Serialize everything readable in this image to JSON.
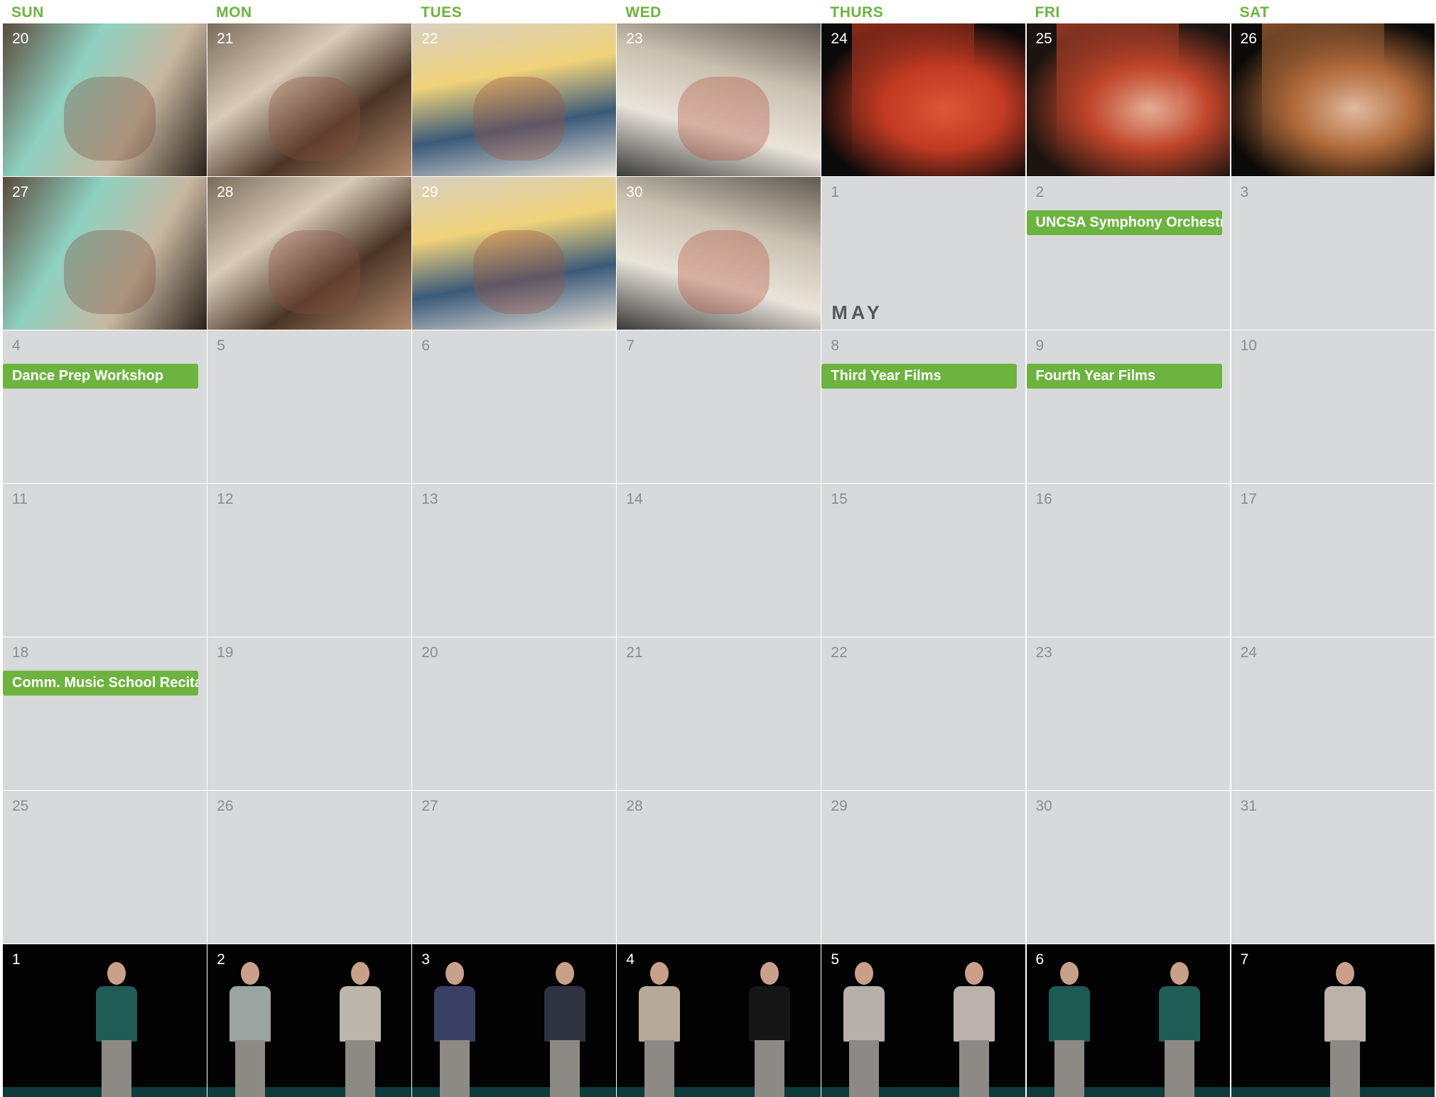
{
  "header": {
    "days": [
      "SUN",
      "MON",
      "TUES",
      "WED",
      "THURS",
      "FRI",
      "SAT"
    ]
  },
  "colors": {
    "accent": "#6db33f",
    "cell_bg": "#d8d9db",
    "day_number": "#8a8c8f",
    "month_label": "#555759"
  },
  "month_label": "MAY",
  "weeks": [
    {
      "days": [
        {
          "num": "20",
          "style": "photo"
        },
        {
          "num": "21",
          "style": "photo"
        },
        {
          "num": "22",
          "style": "photo"
        },
        {
          "num": "23",
          "style": "photo"
        },
        {
          "num": "24",
          "style": "photo-stage"
        },
        {
          "num": "25",
          "style": "photo-stage"
        },
        {
          "num": "26",
          "style": "photo-stage"
        }
      ]
    },
    {
      "days": [
        {
          "num": "27",
          "style": "photo"
        },
        {
          "num": "28",
          "style": "photo"
        },
        {
          "num": "29",
          "style": "photo"
        },
        {
          "num": "30",
          "style": "photo"
        },
        {
          "num": "1",
          "style": "plain",
          "month_start": true
        },
        {
          "num": "2",
          "style": "plain",
          "event": "UNCSA Symphony Orchestra"
        },
        {
          "num": "3",
          "style": "plain"
        }
      ]
    },
    {
      "days": [
        {
          "num": "4",
          "style": "plain",
          "event": "Dance Prep Workshop"
        },
        {
          "num": "5",
          "style": "plain"
        },
        {
          "num": "6",
          "style": "plain"
        },
        {
          "num": "7",
          "style": "plain"
        },
        {
          "num": "8",
          "style": "plain",
          "event": "Third Year Films"
        },
        {
          "num": "9",
          "style": "plain",
          "event": "Fourth Year Films"
        },
        {
          "num": "10",
          "style": "plain"
        }
      ]
    },
    {
      "days": [
        {
          "num": "11",
          "style": "plain"
        },
        {
          "num": "12",
          "style": "plain"
        },
        {
          "num": "13",
          "style": "plain"
        },
        {
          "num": "14",
          "style": "plain"
        },
        {
          "num": "15",
          "style": "plain"
        },
        {
          "num": "16",
          "style": "plain"
        },
        {
          "num": "17",
          "style": "plain"
        }
      ]
    },
    {
      "days": [
        {
          "num": "18",
          "style": "plain",
          "event": "Comm. Music School Recital"
        },
        {
          "num": "19",
          "style": "plain"
        },
        {
          "num": "20",
          "style": "plain"
        },
        {
          "num": "21",
          "style": "plain"
        },
        {
          "num": "22",
          "style": "plain"
        },
        {
          "num": "23",
          "style": "plain"
        },
        {
          "num": "24",
          "style": "plain"
        }
      ]
    },
    {
      "days": [
        {
          "num": "25",
          "style": "plain"
        },
        {
          "num": "26",
          "style": "plain"
        },
        {
          "num": "27",
          "style": "plain"
        },
        {
          "num": "28",
          "style": "plain"
        },
        {
          "num": "29",
          "style": "plain"
        },
        {
          "num": "30",
          "style": "plain"
        },
        {
          "num": "31",
          "style": "plain"
        }
      ]
    },
    {
      "days": [
        {
          "num": "1",
          "style": "photo-dancers"
        },
        {
          "num": "2",
          "style": "photo-dancers"
        },
        {
          "num": "3",
          "style": "photo-dancers"
        },
        {
          "num": "4",
          "style": "photo-dancers"
        },
        {
          "num": "5",
          "style": "photo-dancers"
        },
        {
          "num": "6",
          "style": "photo-dancers"
        },
        {
          "num": "7",
          "style": "photo-dancers"
        }
      ]
    }
  ]
}
